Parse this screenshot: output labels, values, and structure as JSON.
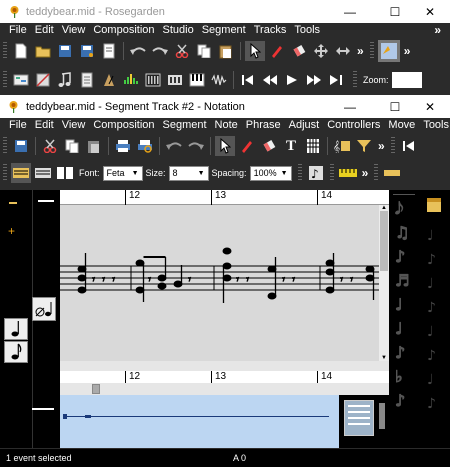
{
  "main_window": {
    "title": "teddybear.mid - Rosegarden",
    "menu": [
      "File",
      "Edit",
      "View",
      "Composition",
      "Studio",
      "Segment",
      "Tracks",
      "Tools"
    ],
    "zoom_label": "Zoom:"
  },
  "notation_window": {
    "title": "teddybear.mid - Segment Track #2 - Notation",
    "menu": [
      "File",
      "Edit",
      "View",
      "Composition",
      "Segment",
      "Note",
      "Phrase",
      "Adjust",
      "Controllers",
      "Move",
      "Tools"
    ],
    "font_label": "Font:",
    "font_value": "Feta",
    "size_label": "Size:",
    "size_value": "8",
    "spacing_label": "Spacing:",
    "spacing_value": "100%",
    "bar_numbers": [
      "12",
      "13",
      "14"
    ],
    "bar_numbers_lower": [
      "12",
      "13",
      "14"
    ]
  },
  "status": {
    "left": "1 event selected",
    "center": "A 0"
  },
  "window_controls": {
    "minimize": "—",
    "maximize": "☐",
    "close": "✕"
  },
  "colors": {
    "matrix_bg": "#bcd6f2",
    "score_bg": "#d9d9d9",
    "toolbar_bg": "#2b2b2b"
  }
}
